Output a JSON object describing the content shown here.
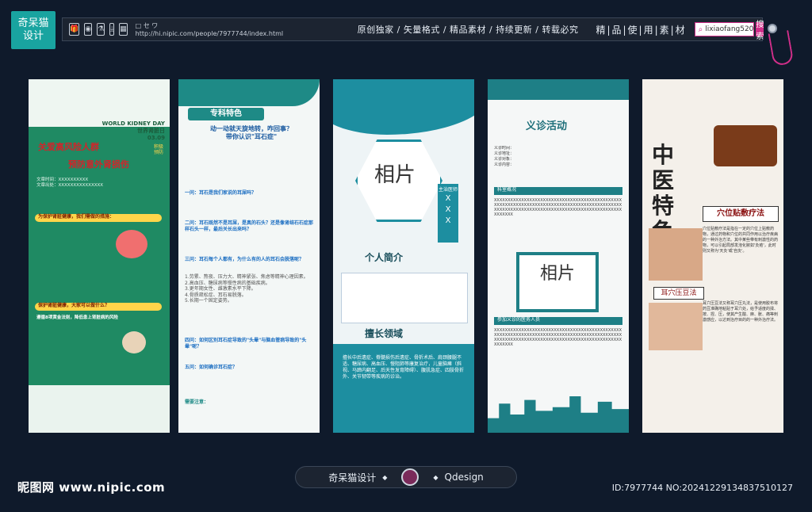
{
  "header": {
    "logo_text": [
      "奇呆猫",
      "设计"
    ],
    "url": "http://hi.nipic.com/people/7977744/index.html",
    "slogan": "原创独家 / 矢量格式 / 精品素材 / 持续更新 / 转载必究",
    "jingpin": "精|品|使|用|素|材",
    "search_value": "lixiaofang520",
    "search_button": "搜索",
    "toolbar_icons": [
      "gift-icon",
      "camera-icon",
      "flask-icon",
      "download-icon",
      "image-icon"
    ],
    "toolbar_small": "□ セ ワ"
  },
  "panels": {
    "p1": {
      "date": "WORLD KIDNEY DAY\n世界肾脏日\n03.09",
      "side_note": "积极预防",
      "title1": "关爱高风险人群",
      "title2": "预防意外肾损伤",
      "bar1": "为保护肾脏健康，我们需做的措施：",
      "bar2": "保护肾脏健康，大家可以做什么？",
      "bar3": "遵循8项黄金法则，降低患上肾脏病的风险",
      "info": "文章时间：XXXXXXXXXX\n文章出处：XXXXXXXXXXXXXXX"
    },
    "p2": {
      "tag": "专科特色",
      "question": "动一动就天旋地转，咋回事？\n带你认识\"耳石症\"",
      "h1": "一问：耳石是我们家说的耳屎吗？",
      "h2": "二问：耳石既然不是耳屎，是真的石头？还是像肾结石石症那样石头一样，最后关长出来吗？",
      "h3": "三问：耳石每个人都有，为什么有的人的耳石会脱落呢？",
      "h4": "四问：如何区别耳石症导致的\"头晕\"与脑血管病导致的\"头晕\"呢？",
      "h5": "五问：如何确诊耳石症？",
      "h6": "需要注意：",
      "list": "1.劳累、熬夜、压力大、精神紧张、焦虑等精神心理因素。\n2.高血压、糖尿病等慢性病的基础疾病。\n3.更年期女性、雌激素水平下降。\n4.骨质疏松症、耳石易脱落。\n5.长期一个固定姿势。"
    },
    "p3": {
      "photo": "相片",
      "name_label": "主治医师",
      "name": "XXX",
      "sec1": "个人简介",
      "sec2": "擅长领域",
      "detail": "擅长中后遗症、脊髓损伤后遗症、骨折术后、肩颈腰腿不适、糖尿病、高血压、慢阻肺等康复治疗，儿童脑瘫（斜视、马蹄内翻足、后天性发育障碍）、腹肌急症、四肢骨折外、关节韧带等疾病的诊治。"
    },
    "p4": {
      "title": "义诊活动",
      "h1": "科室概况",
      "h2": "参加义诊的医务人员",
      "photo": "相片",
      "x_text": "XXXXXXXXXXXXXXXXXXXXXXXXXXXXXXXXXXXXXXXXXXXXXXXXXXXXXXXXXXXXXXXXXXXXXXXXXXXXXXXXXXXXXXXXXXXXXXXXXXXXXXXXXXXXXXXXXXXXXXXXXXXXXXXXXXXXXXXXXXXXXXXXXXXX",
      "info": "义诊时间：\n义诊地址：\n义诊对象：\n义诊内容："
    },
    "p5": {
      "title": "中医特色",
      "tag1": "穴位贴敷疗法",
      "tag2": "耳穴压豆法",
      "text1": "穴位贴敷疗法是指在一定的穴位上贴敷药物，通过药物和穴位的共同作用以治疗疾病的一种外治方法。其中某些带有刺激性的药物，可以引起局部发泡化脓如'灸疮'，此时则又称为'天灸'或'自灸'。",
      "text2": "耳穴压豆法又称耳穴压丸法，是使用胶布将药豆准确地粘贴于耳穴处，给予适度的揉、按、捏、压，使其产生酸、麻、胀、痛等刺激感应，以达到治疗目的的一种外治疗法。"
    }
  },
  "footer": {
    "brand": "奇呆猫设计",
    "qdesign": "Qdesign",
    "site": "昵图网 www.nipic.com",
    "id_text": "ID:7977744 NO:20241229134837510127"
  },
  "colors": {
    "teal": "#1e8a86",
    "green": "#1f8a63",
    "pink": "#d12f8a",
    "red": "#d3232a"
  }
}
